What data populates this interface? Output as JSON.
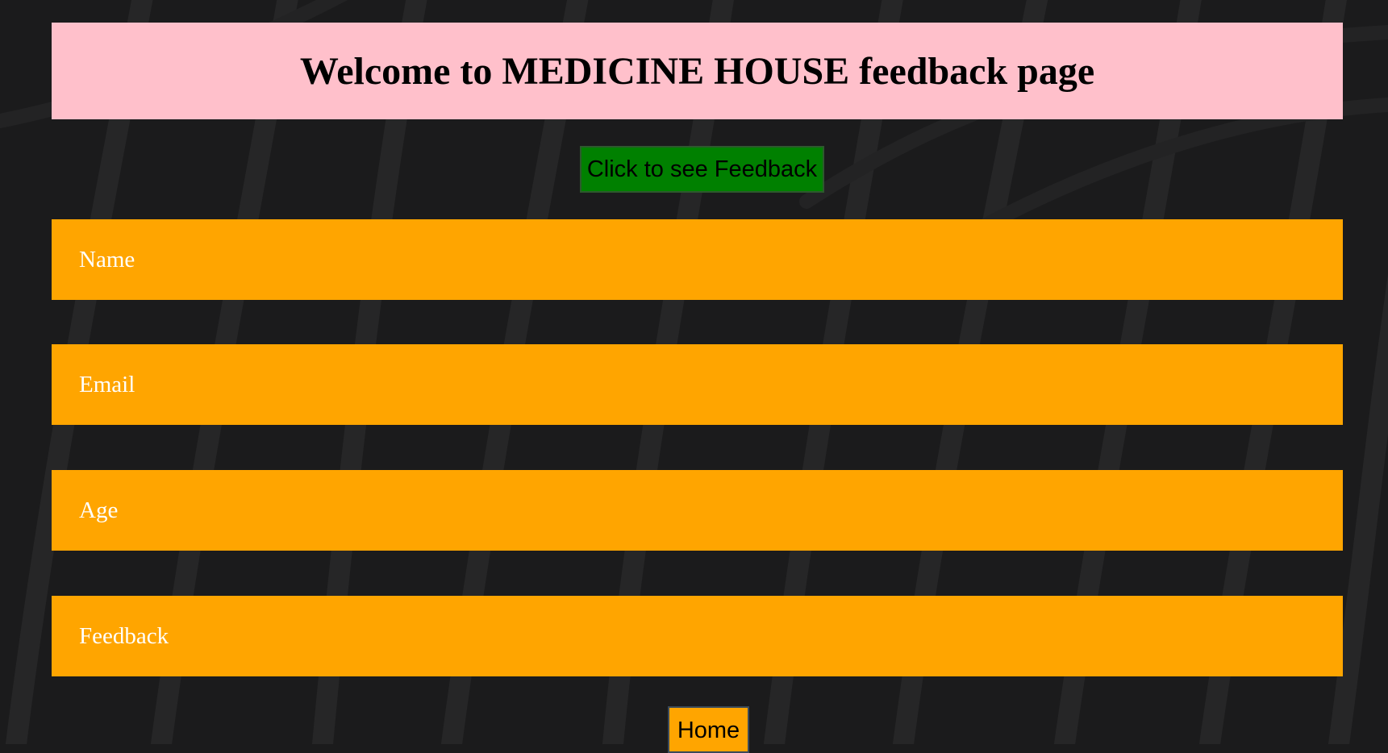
{
  "page": {
    "background_color": "#1b1b1c"
  },
  "header": {
    "title": "Welcome to MEDICINE HOUSE feedback page",
    "background_color": "#ffc0cb"
  },
  "feedback_button": {
    "label": "Click to see Feedback",
    "background_color": "#008000"
  },
  "form": {
    "field_background_color": "#ffa500",
    "fields": [
      {
        "placeholder": "Name",
        "value": ""
      },
      {
        "placeholder": "Email",
        "value": ""
      },
      {
        "placeholder": "Age",
        "value": ""
      },
      {
        "placeholder": "Feedback",
        "value": ""
      }
    ]
  },
  "home_button": {
    "label": "Home",
    "background_color": "#ffa500"
  }
}
